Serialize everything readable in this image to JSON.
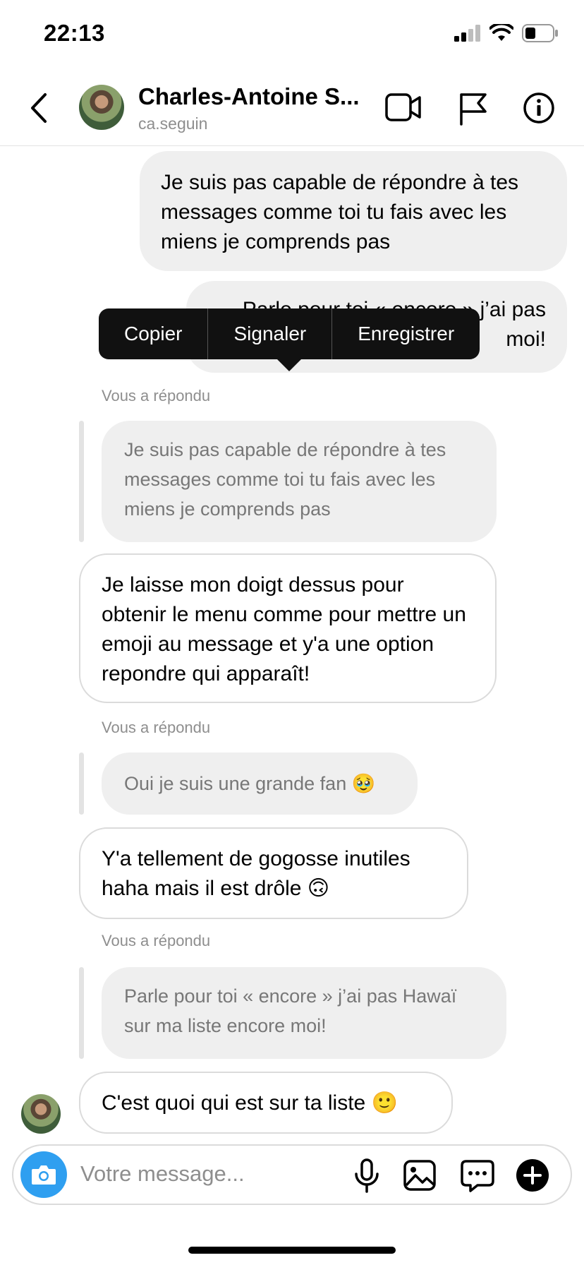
{
  "status_bar": {
    "time": "22:13"
  },
  "header": {
    "name": "Charles-Antoine S...",
    "username": "ca.seguin"
  },
  "context_menu": {
    "items": [
      "Copier",
      "Signaler",
      "Enregistrer"
    ]
  },
  "messages": {
    "out_1": "Je suis pas capable de répondre à tes messages comme toi tu fais avec les miens je comprends pas",
    "out_2_line1": "Parle pour toi « encore » j’ai pas",
    "out_2_line2": "moi!",
    "reply_1": {
      "label": "Vous a répondu",
      "quoted": "Je suis pas capable de répondre à tes messages comme toi tu fais avec les miens je comprends pas",
      "text": "Je laisse mon doigt dessus pour obtenir le menu comme pour mettre un emoji au message et y'a une option repondre qui apparaît!"
    },
    "reply_2": {
      "label": "Vous a répondu",
      "quoted": "Oui je suis une grande fan 🥹",
      "text": "Y'a tellement de gogosse inutiles haha mais il est drôle 🙃"
    },
    "reply_3": {
      "label": "Vous a répondu",
      "quoted": "Parle pour toi « encore » j’ai pas Hawaï sur ma liste encore moi!",
      "text": "C'est quoi qui est sur ta liste 🙂"
    }
  },
  "composer": {
    "placeholder": "Votre message..."
  },
  "colors": {
    "accent": "#2f9ff0",
    "bubble_out": "#efefef",
    "border": "#dbdbdb",
    "muted": "#8e8e8e"
  },
  "icons": [
    "back-icon",
    "video-call-icon",
    "flag-icon",
    "info-icon",
    "camera-icon",
    "microphone-icon",
    "gallery-icon",
    "sticker-icon",
    "plus-icon"
  ]
}
